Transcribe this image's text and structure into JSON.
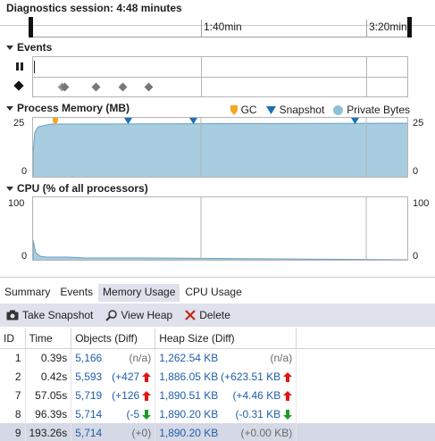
{
  "session": {
    "title": "Diagnostics session: 4:48 minutes"
  },
  "timeline": {
    "ticks": [
      "1:40min",
      "3:20min"
    ]
  },
  "events": {
    "title": "Events"
  },
  "memory": {
    "title": "Process Memory (MB)",
    "legend": [
      {
        "label": "GC",
        "color": "#f5a623"
      },
      {
        "label": "Snapshot",
        "color": "#1f6fb5"
      },
      {
        "label": "Private Bytes",
        "color": "#a8cce0"
      }
    ],
    "y_top": "25",
    "y_bottom": "0"
  },
  "cpu": {
    "title": "CPU (% of all processors)",
    "y_top": "100",
    "y_bottom": "0"
  },
  "tabs": [
    "Summary",
    "Events",
    "Memory Usage",
    "CPU Usage"
  ],
  "toolbar": {
    "take_snapshot": "Take Snapshot",
    "view_heap": "View Heap",
    "delete": "Delete"
  },
  "table": {
    "headers": [
      "ID",
      "Time",
      "Objects (Diff)",
      "Heap Size (Diff)"
    ],
    "rows": [
      {
        "id": "1",
        "time": "0.39s",
        "objects": "5,166",
        "obj_diff": "(n/a)",
        "obj_arrow": "",
        "heap": "1,262.54 KB",
        "heap_diff": "(n/a)",
        "heap_arrow": ""
      },
      {
        "id": "2",
        "time": "0.42s",
        "objects": "5,593",
        "obj_diff": "(+427",
        "obj_arrow": "up",
        "heap": "1,886.05 KB",
        "heap_diff": "(+623.51 KB",
        "heap_arrow": "up"
      },
      {
        "id": "7",
        "time": "57.05s",
        "objects": "5,719",
        "obj_diff": "(+126",
        "obj_arrow": "up",
        "heap": "1,890.51 KB",
        "heap_diff": "(+4.46 KB",
        "heap_arrow": "up"
      },
      {
        "id": "8",
        "time": "96.39s",
        "objects": "5,714",
        "obj_diff": "(-5",
        "obj_arrow": "down",
        "heap": "1,890.20 KB",
        "heap_diff": "(-0.31 KB",
        "heap_arrow": "down"
      },
      {
        "id": "9",
        "time": "193.26s",
        "objects": "5,714",
        "obj_diff": "(+0)",
        "obj_arrow": "",
        "heap": "1,890.20 KB",
        "heap_diff": "(+0.00 KB)",
        "heap_arrow": ""
      }
    ]
  }
}
